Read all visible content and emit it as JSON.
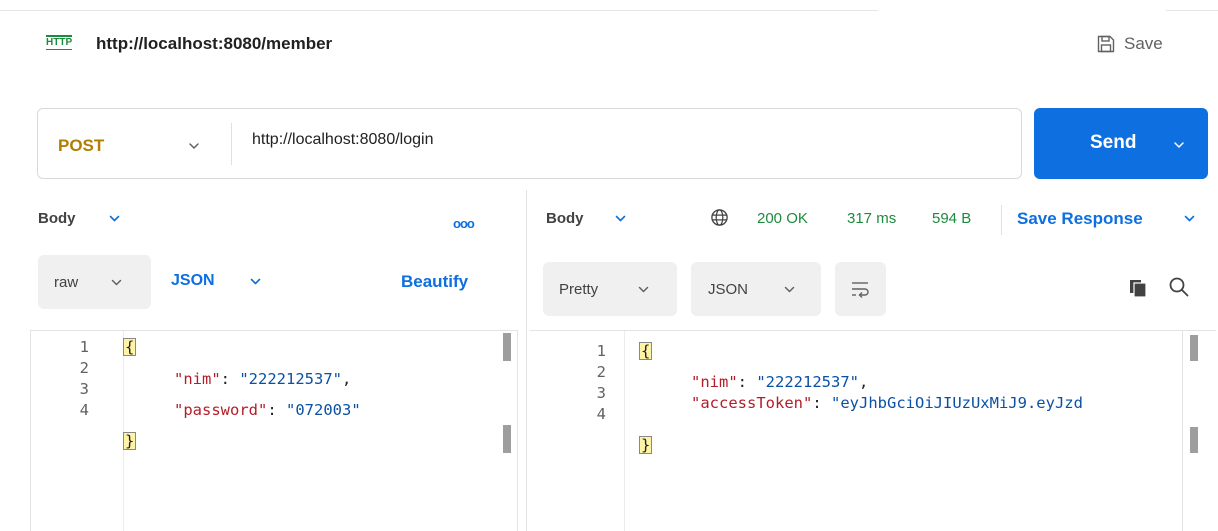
{
  "header": {
    "icon_text": "HTTP",
    "title": "http://localhost:8080/member",
    "save_label": "Save"
  },
  "request": {
    "method": "POST",
    "url": "http://localhost:8080/login",
    "send_label": "Send"
  },
  "request_pane": {
    "tab_label": "Body",
    "more_label": "ooo",
    "body_type": "raw",
    "format": "JSON",
    "beautify_label": "Beautify",
    "lines": [
      {
        "num": "1",
        "text": "{"
      },
      {
        "num": "2",
        "key": "\"nim\"",
        "sep": ": ",
        "value": "\"222212537\"",
        "tail": ","
      },
      {
        "num": "3",
        "key": "\"password\"",
        "sep": ": ",
        "value": "\"072003\"",
        "tail": ""
      },
      {
        "num": "4",
        "text": "}"
      }
    ]
  },
  "response_pane": {
    "tab_label": "Body",
    "status": "200 OK",
    "time": "317 ms",
    "size": "594 B",
    "save_response_label": "Save Response",
    "view_mode": "Pretty",
    "format": "JSON",
    "lines": [
      {
        "num": "1",
        "text": "{"
      },
      {
        "num": "2",
        "key": "\"nim\"",
        "sep": ": ",
        "value": "\"222212537\"",
        "tail": ","
      },
      {
        "num": "3",
        "key": "\"accessToken\"",
        "sep": ": ",
        "value": "\"eyJhbGciOiJIUzUxMiJ9.eyJzd",
        "tail": ""
      },
      {
        "num": "4",
        "text": "}"
      }
    ]
  },
  "colors": {
    "accent": "#0d6fe0",
    "method": "#b27d00",
    "status_ok": "#1e8a3e",
    "json_key": "#b31d28",
    "json_string": "#0a51a6"
  }
}
